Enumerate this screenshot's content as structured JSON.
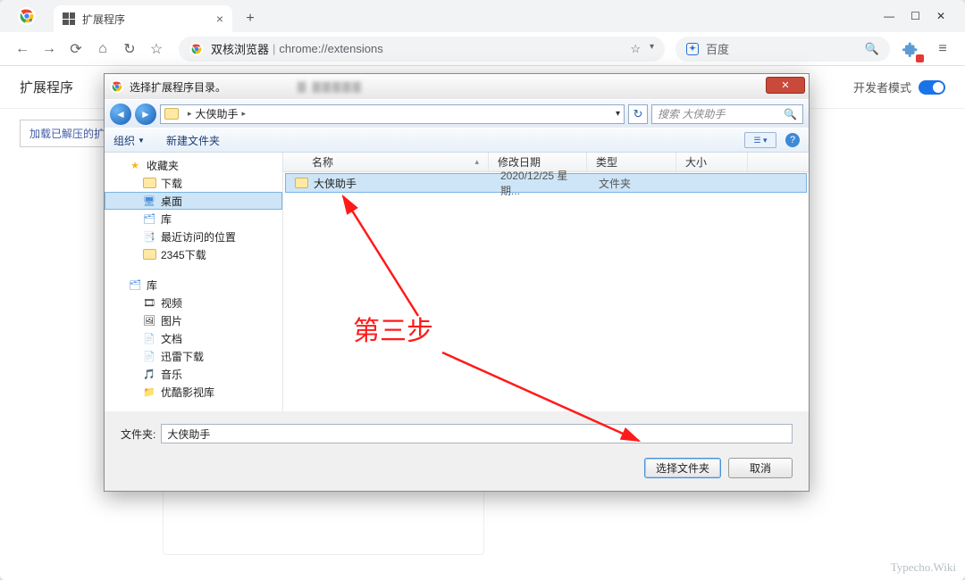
{
  "browser": {
    "tab_title": "扩展程序",
    "address_label": "双核浏览器",
    "address_url": "chrome://extensions",
    "search_engine": "百度"
  },
  "page": {
    "header": "扩展程序",
    "dev_mode_label": "开发者模式",
    "load_unpacked": "加载已解压的扩"
  },
  "dialog": {
    "title": "选择扩展程序目录。",
    "breadcrumb_root": "大侠助手",
    "search_placeholder": "搜索 大侠助手",
    "toolbar": {
      "organize": "组织",
      "new_folder": "新建文件夹"
    },
    "columns": {
      "name": "名称",
      "date": "修改日期",
      "type": "类型",
      "size": "大小"
    },
    "side_tree": {
      "favorites": "收藏夹",
      "downloads": "下载",
      "desktop": "桌面",
      "libraries": "库",
      "recent": "最近访问的位置",
      "dl2345": "2345下载",
      "libs": "库",
      "video": "视频",
      "pictures": "图片",
      "documents": "文档",
      "thunder": "迅雷下载",
      "music": "音乐",
      "youku": "优酷影视库"
    },
    "files": [
      {
        "name": "大侠助手",
        "date": "2020/12/25 星期...",
        "type": "文件夹",
        "size": ""
      }
    ],
    "folder_label": "文件夹:",
    "folder_value": "大侠助手",
    "select_btn": "选择文件夹",
    "cancel_btn": "取消"
  },
  "annotation": "第三步",
  "watermark": "Typecho.Wiki"
}
